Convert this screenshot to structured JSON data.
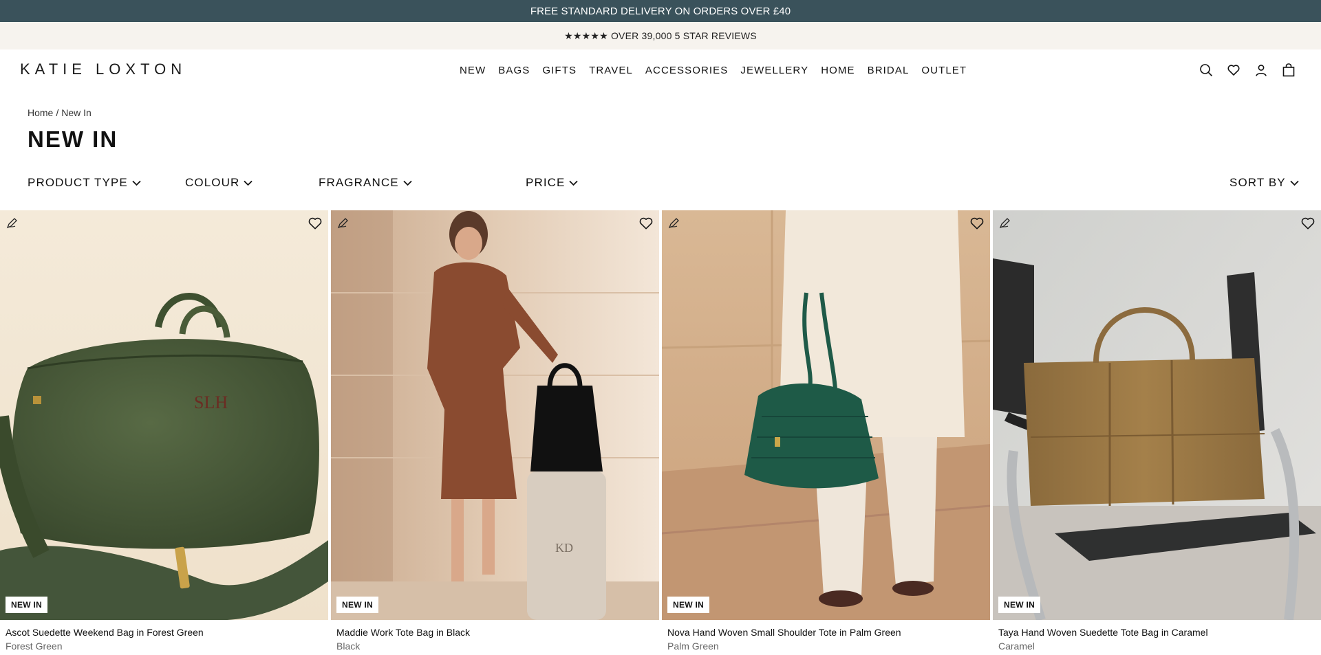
{
  "promo": {
    "text": "FREE STANDARD DELIVERY ON ORDERS OVER £40"
  },
  "reviews": {
    "text": "★★★★★ OVER 39,000 5 STAR REVIEWS"
  },
  "header": {
    "logo": "KATIE LOXTON",
    "nav": [
      "NEW",
      "BAGS",
      "GIFTS",
      "TRAVEL",
      "ACCESSORIES",
      "JEWELLERY",
      "HOME",
      "BRIDAL",
      "OUTLET"
    ],
    "icons": [
      "search-icon",
      "heart-icon",
      "account-icon",
      "bag-icon"
    ]
  },
  "breadcrumb": {
    "home": "Home",
    "separator": "/",
    "current": "New In"
  },
  "page": {
    "title": "NEW IN"
  },
  "filters": {
    "product_type": "PRODUCT TYPE",
    "colour": "COLOUR",
    "fragrance": "FRAGRANCE",
    "price": "PRICE",
    "sort": "SORT BY"
  },
  "products": [
    {
      "name": "Ascot Suedette Weekend Bag in Forest Green",
      "colour": "Forest Green",
      "badge": "NEW IN",
      "monogram": "SLH"
    },
    {
      "name": "Maddie Work Tote Bag in Black",
      "colour": "Black",
      "badge": "NEW IN",
      "monogram": "KD"
    },
    {
      "name": "Nova Hand Woven Small Shoulder Tote in Palm Green",
      "colour": "Palm Green",
      "badge": "NEW IN"
    },
    {
      "name": "Taya Hand Woven Suedette Tote Bag in Caramel",
      "colour": "Caramel",
      "badge": "NEW IN"
    }
  ],
  "colors": {
    "promo_bg": "#3a525b",
    "reviews_bg": "#f6f3ee"
  }
}
